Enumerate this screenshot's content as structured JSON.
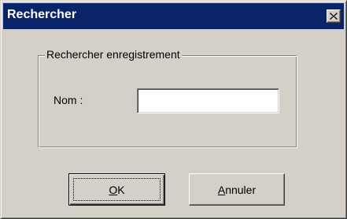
{
  "window": {
    "title": "Rechercher",
    "close_icon": "close-icon"
  },
  "group": {
    "legend": "Rechercher enregistrement",
    "name_label": "Nom :",
    "name_value": "",
    "name_placeholder": ""
  },
  "buttons": {
    "ok": {
      "mnemonic": "O",
      "rest": "K"
    },
    "cancel": {
      "mnemonic": "A",
      "rest": "nnuler"
    }
  },
  "colors": {
    "titlebar": "#0a246a",
    "face": "#d4d0c8"
  }
}
